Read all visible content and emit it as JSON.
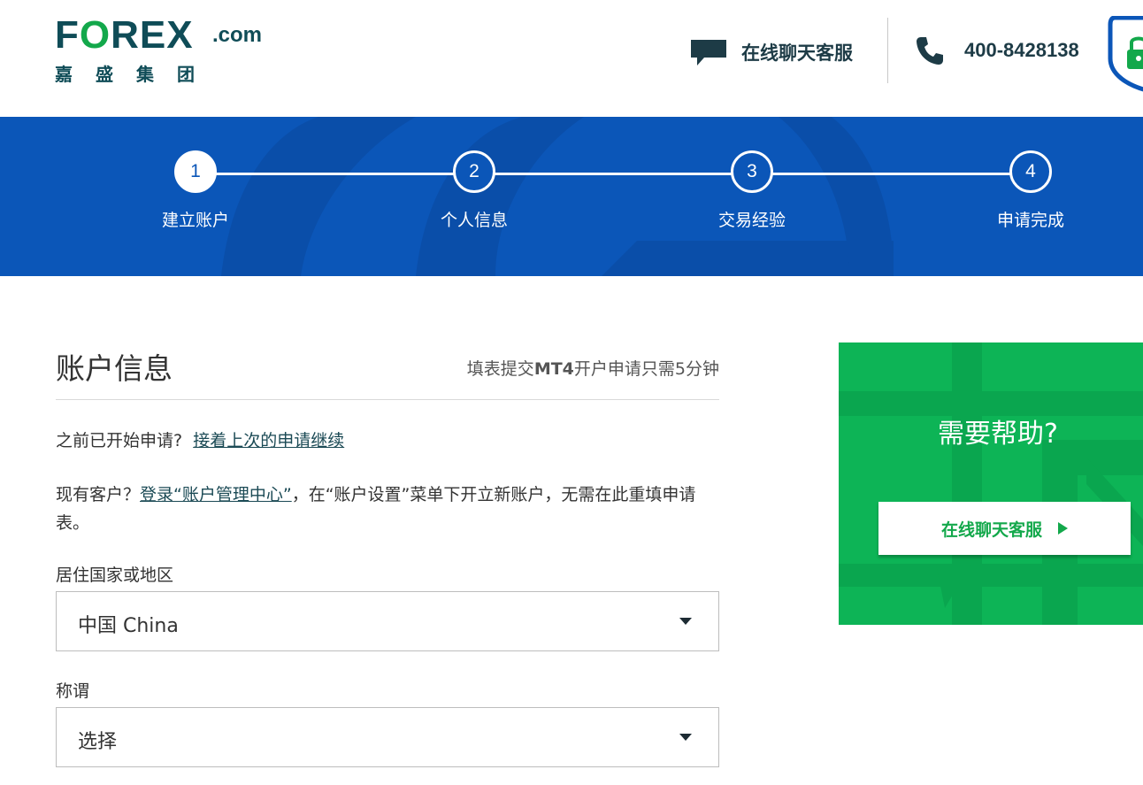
{
  "header": {
    "logo": {
      "main_prefix": "F",
      "main_o": "O",
      "main_suffix": "REX",
      "dotcom": ".com",
      "sub": "嘉盛集团"
    },
    "chat_label": "在线聊天客服",
    "phone_label": "400-8428138",
    "icons": [
      "chat-bubble-icon",
      "phone-icon",
      "lock-shield-icon"
    ]
  },
  "progress": {
    "steps": [
      {
        "number": "1",
        "label": "建立账户",
        "active": true
      },
      {
        "number": "2",
        "label": "个人信息",
        "active": false
      },
      {
        "number": "3",
        "label": "交易经验",
        "active": false
      },
      {
        "number": "4",
        "label": "申请完成",
        "active": false
      }
    ]
  },
  "form": {
    "title": "账户信息",
    "note_prefix": "填表提交",
    "note_bold": "MT4",
    "note_suffix": "开户申请只需5分钟",
    "resume_text": "之前已开始申请?",
    "resume_link": "接着上次的申请继续",
    "existing_prefix": "现有客户？",
    "existing_link": "登录“账户管理中心”",
    "existing_suffix": "，在“账户设置”菜单下开立新账户，无需在此重填申请表。",
    "country_label": "居住国家或地区",
    "country_value": "中国 China",
    "salutation_label": "称谓",
    "salutation_value": "选择"
  },
  "help": {
    "title": "需要帮助?",
    "button_label": "在线聊天客服"
  },
  "colors": {
    "brand_dark": "#0f4c57",
    "brand_green": "#13a84b",
    "progress_blue": "#0b56b8",
    "help_green": "#0db456"
  }
}
